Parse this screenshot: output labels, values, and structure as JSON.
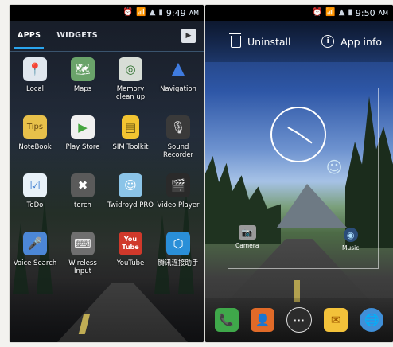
{
  "left_screen": {
    "status": {
      "time": "9:49",
      "ampm": "AM"
    },
    "tabs": [
      {
        "label": "APPS",
        "active": true
      },
      {
        "label": "WIDGETS",
        "active": false
      }
    ],
    "store_icon": "play-store-icon",
    "apps": [
      {
        "label": "Local",
        "icon": "map-pin-icon",
        "color": "#e0e7ee"
      },
      {
        "label": "Maps",
        "icon": "maps-icon",
        "color": "#6aa36a"
      },
      {
        "label": "Memory clean up",
        "icon": "memory-clean-icon",
        "color": "#d7ddd6"
      },
      {
        "label": "Navigation",
        "icon": "navigation-arrow-icon",
        "color": "#2d63c8"
      },
      {
        "label": "NoteBook",
        "icon": "notebook-icon",
        "color": "#e7c04a"
      },
      {
        "label": "Play Store",
        "icon": "play-store-icon",
        "color": "#f0f0f0"
      },
      {
        "label": "SIM Toolkit",
        "icon": "sim-card-icon",
        "color": "#f2c431"
      },
      {
        "label": "Sound Recorder",
        "icon": "microphone-icon",
        "color": "#3a3a3a"
      },
      {
        "label": "ToDo",
        "icon": "todo-icon",
        "color": "#e8f1f8"
      },
      {
        "label": "torch",
        "icon": "torch-icon",
        "color": "#5a5a5a"
      },
      {
        "label": "Twidroyd PRO",
        "icon": "twidroyd-icon",
        "color": "#8bc4e8"
      },
      {
        "label": "Video Player",
        "icon": "clapperboard-icon",
        "color": "#2a2a2a"
      },
      {
        "label": "Voice Search",
        "icon": "voice-mic-icon",
        "color": "#4c87d6"
      },
      {
        "label": "Wireless Input",
        "icon": "keyboard-mouse-icon",
        "color": "#6f6f6f"
      },
      {
        "label": "YouTube",
        "icon": "youtube-icon",
        "color": "#d0392b"
      },
      {
        "label": "腾讯连接助手",
        "icon": "tencent-assistant-icon",
        "color": "#2a8fd8"
      }
    ]
  },
  "right_screen": {
    "status": {
      "time": "9:50",
      "ampm": "AM"
    },
    "uninstall_label": "Uninstall",
    "app_info_label": "App info",
    "widgets": {
      "camera_label": "Camera",
      "music_label": "Music"
    },
    "dock": [
      {
        "icon": "phone-icon",
        "color": "#3fa84a"
      },
      {
        "icon": "contacts-icon",
        "color": "#e06a28"
      },
      {
        "icon": "app-drawer-icon",
        "color": "#2c2c2c"
      },
      {
        "icon": "email-icon",
        "color": "#f3c23a"
      },
      {
        "icon": "browser-globe-icon",
        "color": "#3f8fd8"
      }
    ]
  }
}
